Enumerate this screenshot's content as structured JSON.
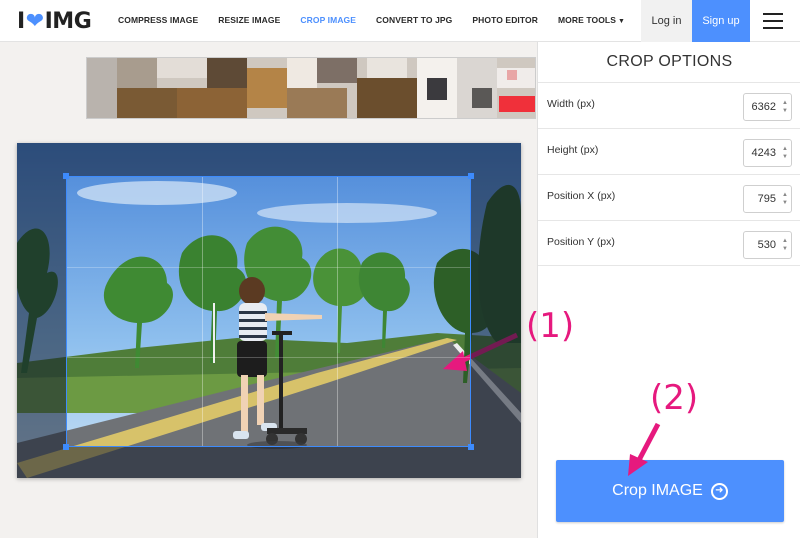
{
  "brand": {
    "logo_left": "I",
    "logo_right": "IMG",
    "accent": "#4d90fe"
  },
  "nav": {
    "items": [
      "COMPRESS IMAGE",
      "RESIZE IMAGE",
      "CROP IMAGE",
      "CONVERT TO JPG",
      "PHOTO EDITOR",
      "MORE TOOLS"
    ],
    "active_index": 2
  },
  "auth": {
    "login": "Log in",
    "signup": "Sign up"
  },
  "panel": {
    "title": "CROP OPTIONS",
    "options": [
      {
        "label": "Width (px)",
        "value": "6362"
      },
      {
        "label": "Height (px)",
        "value": "4243"
      },
      {
        "label": "Position X (px)",
        "value": "795"
      },
      {
        "label": "Position Y (px)",
        "value": "530"
      }
    ],
    "button_label": "Crop IMAGE"
  },
  "annotations": {
    "one": "(1)",
    "two": "(2)",
    "color": "#e6197e"
  }
}
